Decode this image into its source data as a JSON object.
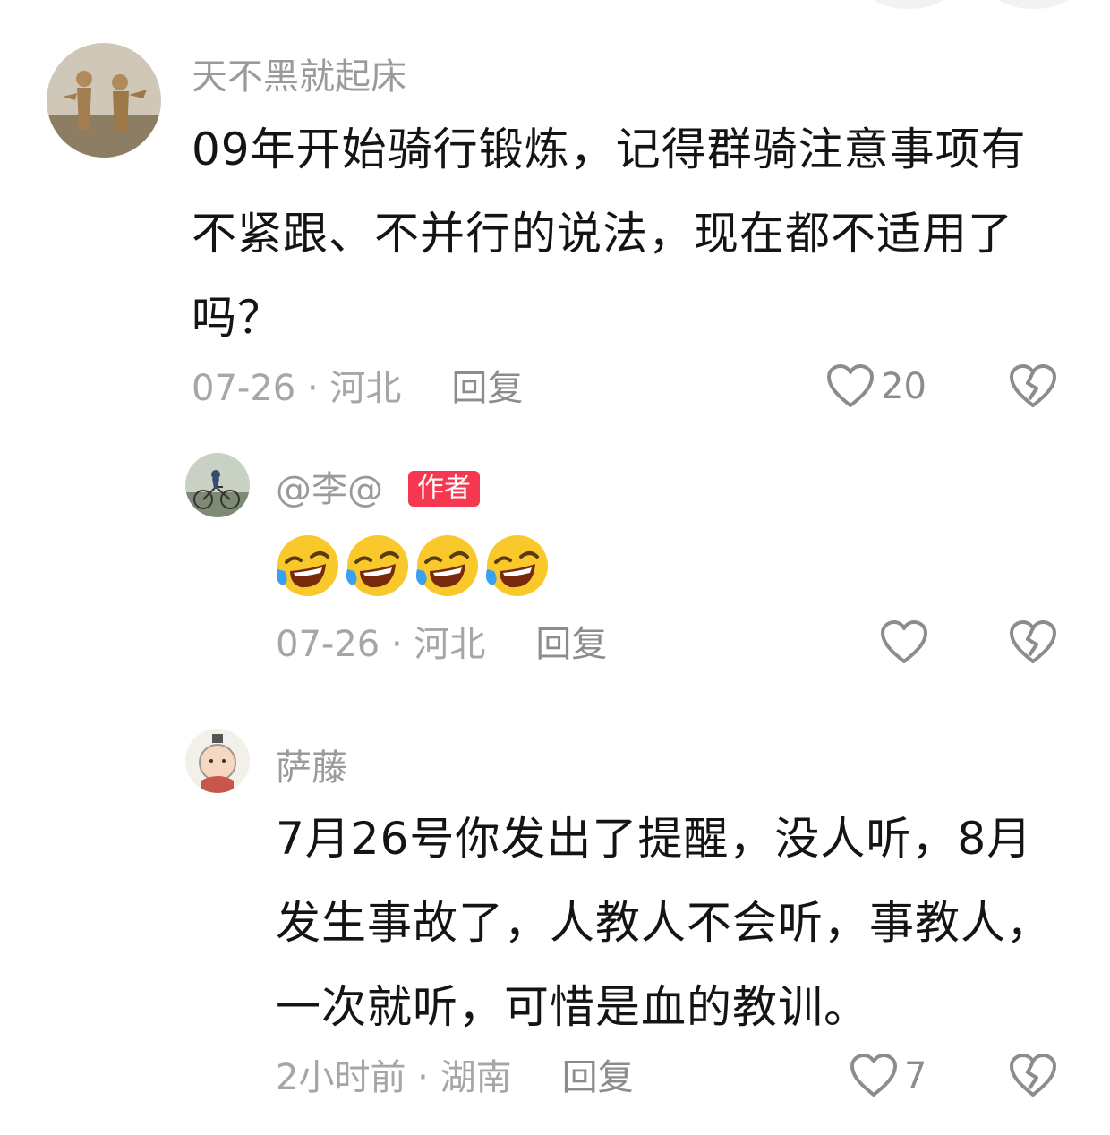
{
  "comments": [
    {
      "username": "天不黑就起床",
      "text": "09年开始骑行锻炼，记得群骑注意事项有不紧跟、不并行的说法，现在都不适用了吗？",
      "date": "07-26",
      "location": "河北",
      "reply_label": "回复",
      "likes": "20"
    },
    {
      "username": "@李@",
      "badge": "作者",
      "date": "07-26",
      "location": "河北",
      "reply_label": "回复",
      "likes": ""
    },
    {
      "username": "萨藤",
      "text": "7月26号你发出了提醒，没人听，8月发生事故了，人教人不会听，事教人，一次就听，可惜是血的教训。",
      "date": "2小时前",
      "location": "湖南",
      "reply_label": "回复",
      "likes": "7"
    }
  ],
  "separator": " · ",
  "icons": {
    "like": "heart-outline-icon",
    "dislike": "broken-heart-icon",
    "emoji": "laughing-tears-emoji"
  },
  "colors": {
    "badge": "#f5374f",
    "meta": "#a6a6a6",
    "username": "#9a9a9a"
  }
}
